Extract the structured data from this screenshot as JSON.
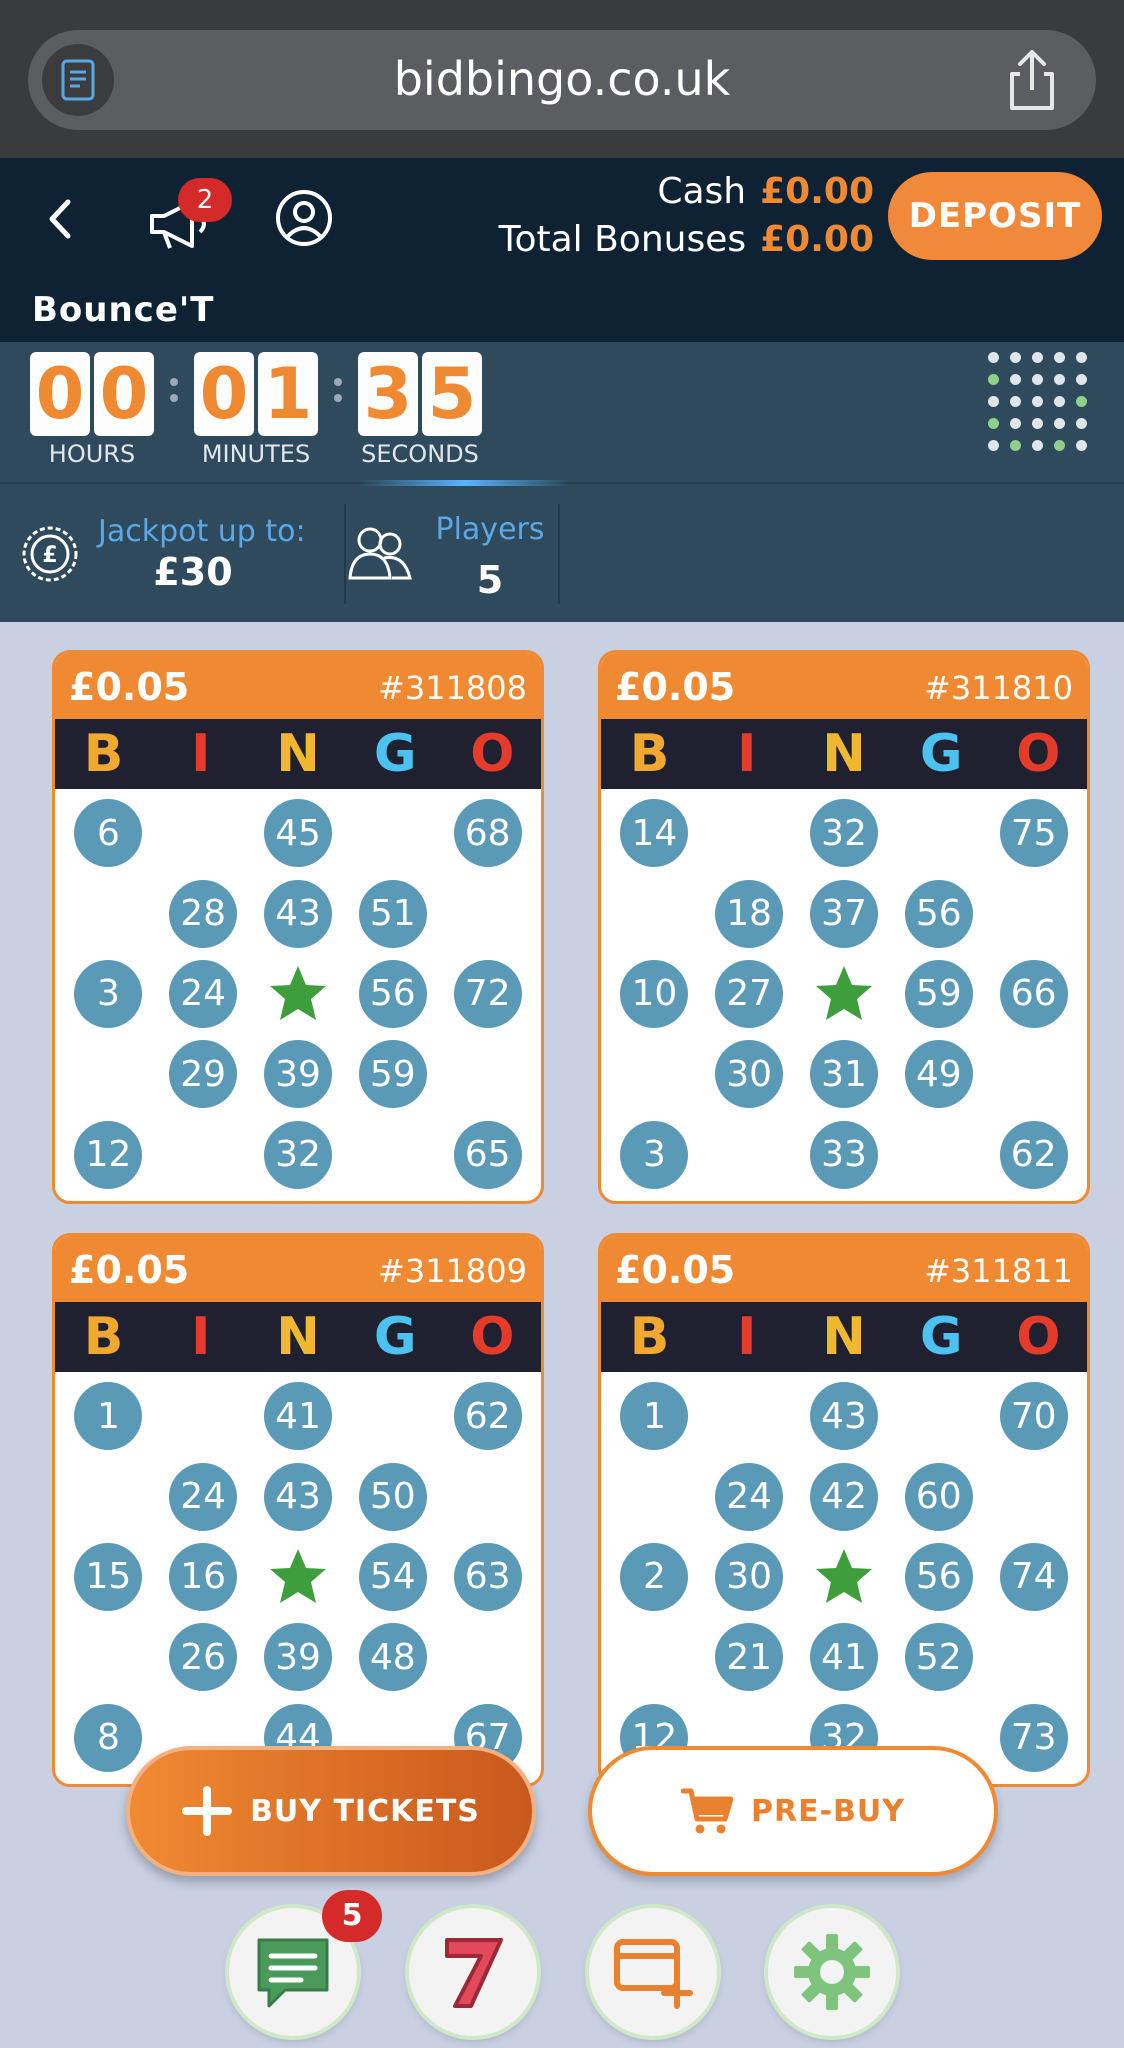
{
  "browser": {
    "url": "bidbingo.co.uk"
  },
  "header": {
    "notification_count": "2",
    "cash_label": "Cash",
    "cash_value": "£0.00",
    "bonuses_label": "Total Bonuses",
    "bonuses_value": "£0.00",
    "deposit_label": "DEPOSIT"
  },
  "room": {
    "title": "Bounce'T"
  },
  "timer": {
    "hours": [
      "0",
      "0"
    ],
    "minutes": [
      "0",
      "1"
    ],
    "seconds": [
      "3",
      "5"
    ],
    "hours_label": "HOURS",
    "minutes_label": "MINUTES",
    "seconds_label": "SECONDS"
  },
  "info": {
    "jackpot_label": "Jackpot up to:",
    "jackpot_value": "£30",
    "players_label": "Players",
    "players_value": "5"
  },
  "bingo_letters": [
    "B",
    "I",
    "N",
    "G",
    "O"
  ],
  "bingo_colors": [
    "#f0a830",
    "#e53b2b",
    "#f0b830",
    "#4cc2f0",
    "#e53b2b"
  ],
  "tickets": [
    {
      "price": "£0.05",
      "id": "#311808",
      "rows": [
        [
          "6",
          "",
          "45",
          "",
          "68"
        ],
        [
          "",
          "28",
          "43",
          "51",
          ""
        ],
        [
          "3",
          "24",
          "*",
          "56",
          "72"
        ],
        [
          "",
          "29",
          "39",
          "59",
          ""
        ],
        [
          "12",
          "",
          "32",
          "",
          "65"
        ]
      ]
    },
    {
      "price": "£0.05",
      "id": "#311810",
      "rows": [
        [
          "14",
          "",
          "32",
          "",
          "75"
        ],
        [
          "",
          "18",
          "37",
          "56",
          ""
        ],
        [
          "10",
          "27",
          "*",
          "59",
          "66"
        ],
        [
          "",
          "30",
          "31",
          "49",
          ""
        ],
        [
          "3",
          "",
          "33",
          "",
          "62"
        ]
      ]
    },
    {
      "price": "£0.05",
      "id": "#311809",
      "rows": [
        [
          "1",
          "",
          "41",
          "",
          "62"
        ],
        [
          "",
          "24",
          "43",
          "50",
          ""
        ],
        [
          "15",
          "16",
          "*",
          "54",
          "63"
        ],
        [
          "",
          "26",
          "39",
          "48",
          ""
        ],
        [
          "8",
          "",
          "44",
          "",
          "67"
        ]
      ]
    },
    {
      "price": "£0.05",
      "id": "#311811",
      "rows": [
        [
          "1",
          "",
          "43",
          "",
          "70"
        ],
        [
          "",
          "24",
          "42",
          "60",
          ""
        ],
        [
          "2",
          "30",
          "*",
          "56",
          "74"
        ],
        [
          "",
          "21",
          "41",
          "52",
          ""
        ],
        [
          "12",
          "",
          "32",
          "",
          "73"
        ]
      ]
    }
  ],
  "actions": {
    "buy_label": "BUY TICKETS",
    "prebuy_label": "PRE-BUY"
  },
  "bottom_nav": {
    "chat_badge": "5"
  },
  "colors": {
    "accent": "#f08a32",
    "header_bg": "#0f2233",
    "ball": "#5b9ab6",
    "star": "#3f9e3c"
  }
}
